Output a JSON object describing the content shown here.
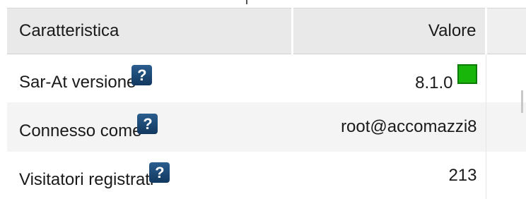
{
  "table": {
    "headers": {
      "name": "Caratteristica",
      "value": "Valore"
    },
    "rows": [
      {
        "name": "Sar-At versione",
        "help": "?",
        "value": "8.1.0",
        "status_color": "#18b50a"
      },
      {
        "name": "Connesso come",
        "help": "?",
        "value": "root@accomazzi8"
      },
      {
        "name": "Visitatori registrati",
        "help": "?",
        "value": "213"
      }
    ]
  },
  "colors": {
    "header_bg": "#e9e9e9",
    "help_badge": "#1f4c78",
    "status_ok": "#18b50a"
  }
}
